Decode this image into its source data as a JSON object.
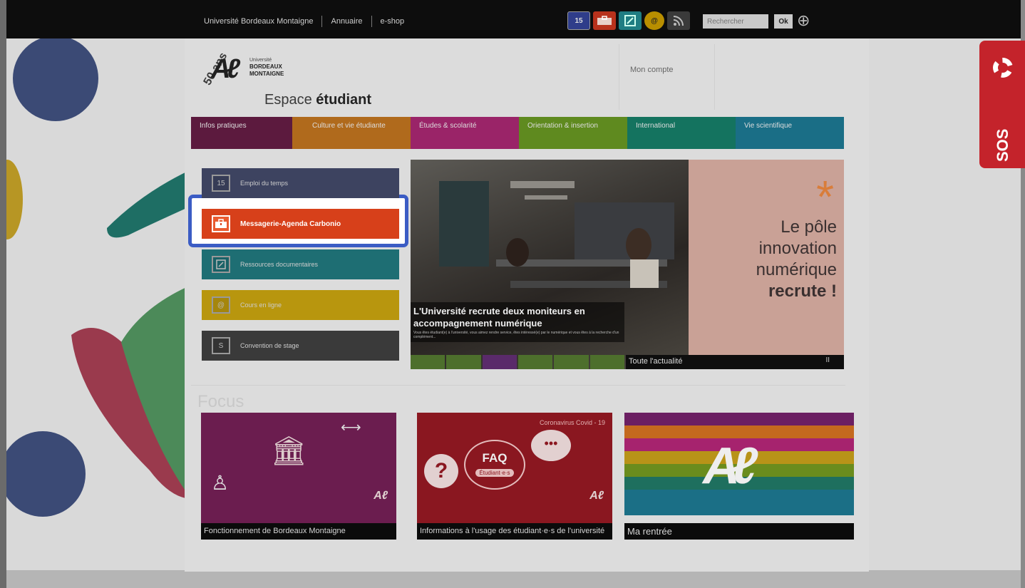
{
  "topbar": {
    "links": [
      "Université Bordeaux Montaigne",
      "Annuaire",
      "e-shop"
    ],
    "icons": [
      {
        "name": "calendar-icon",
        "label": "15"
      },
      {
        "name": "mail-icon",
        "label": ""
      },
      {
        "name": "resources-icon",
        "label": ""
      },
      {
        "name": "web-icon",
        "label": "@"
      },
      {
        "name": "rss-icon",
        "label": ""
      }
    ],
    "search_placeholder": "Rechercher",
    "ok_label": "Ok"
  },
  "header": {
    "logo_fifty": "50 ans",
    "logo_univ_line1": "Université",
    "logo_univ_line2": "BORDEAUX",
    "logo_univ_line3": "MONTAIGNE",
    "espace_prefix": "Espace",
    "espace_bold": "étudiant",
    "mon_compte": "Mon compte"
  },
  "nav": {
    "tabs": [
      {
        "label": "Infos pratiques",
        "color": "#5c1a3e"
      },
      {
        "label": "Culture et vie étudiante",
        "color": "#b06a1c"
      },
      {
        "label": "Études & scolarité",
        "color": "#9a2468"
      },
      {
        "label": "Orientation & insertion",
        "color": "#5f8a1f"
      },
      {
        "label": "International",
        "color": "#14735f"
      },
      {
        "label": "Vie scientifique",
        "color": "#1a6e86"
      }
    ]
  },
  "quicklinks": {
    "emploi": "Emploi du temps",
    "emploi_icon": "15",
    "messagerie": "Messagerie-Agenda Carbonio",
    "ressources": "Ressources documentaires",
    "cours": "Cours en ligne",
    "convention": "Convention de stage",
    "convention_icon": "S"
  },
  "news": {
    "headline": "L'Université recrute deux moniteurs en accompagnement numérique",
    "summary": "Vous êtes étudiant(e) à l'université, vous aimez rendre service, êtes intéressé(e) par le numérique et vous êtes à la recherche d'un complément...",
    "poster_line1": "Le pôle",
    "poster_line2": "innovation",
    "poster_line3": "numérique",
    "poster_line4": "recrute !",
    "all_news": "Toute l'actualité",
    "pause": "II"
  },
  "focus": {
    "title": "Focus",
    "cards": [
      {
        "label": "Fonctionnement de Bordeaux Montaigne"
      },
      {
        "label": "Informations à l'usage des étudiant·e·s de l'université",
        "tag": "Coronavirus Covid - 19",
        "faq": "FAQ",
        "faq_sub": "Étudiant·e·s"
      },
      {
        "label": "Ma rentrée"
      }
    ]
  },
  "sos": {
    "label": "SOS"
  },
  "colors": {
    "highlight": "#3b5cc4",
    "messagerie": "#d7401a",
    "sos": "#c4232b"
  }
}
